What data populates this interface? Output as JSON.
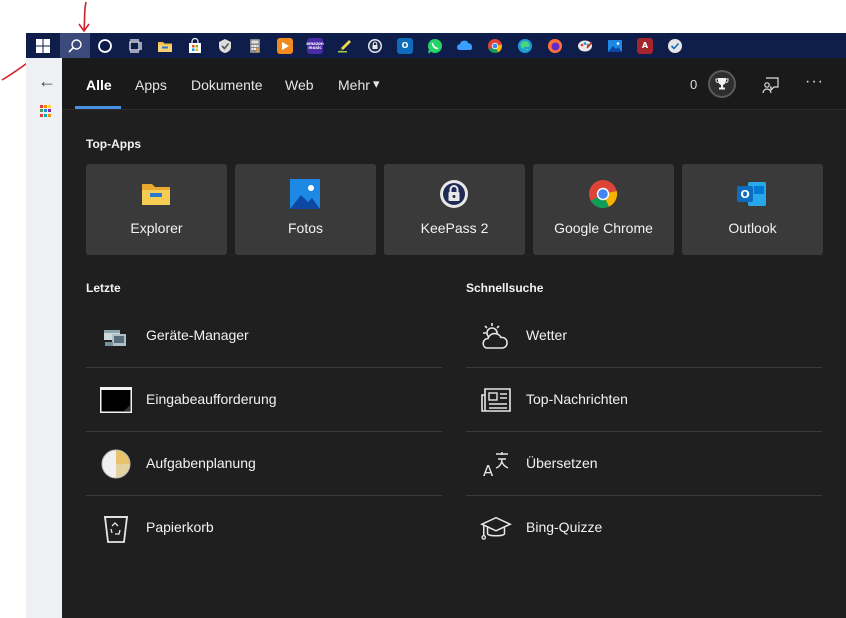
{
  "taskbar": {
    "start": "start-button",
    "items": [
      "search",
      "cortana",
      "task-view",
      "file-explorer",
      "store",
      "tasks-app",
      "calculator",
      "media-player",
      "amazon-music",
      "pen-app",
      "keepass",
      "outlook",
      "whatsapp",
      "onedrive",
      "chrome",
      "edge",
      "firefox",
      "paint",
      "photos",
      "access",
      "feedback"
    ],
    "amazon_music_label": "amazon music",
    "outlook_label": "O",
    "access_label": "A"
  },
  "search_panel": {
    "tabs": [
      {
        "label": "Alle",
        "active": true
      },
      {
        "label": "Apps"
      },
      {
        "label": "Dokumente"
      },
      {
        "label": "Web"
      },
      {
        "label": "Mehr"
      }
    ],
    "more_arrow": "▾",
    "points": "0",
    "more_options": "···",
    "top_apps_title": "Top-Apps",
    "top_apps": [
      {
        "label": "Explorer",
        "icon": "folder-icon"
      },
      {
        "label": "Fotos",
        "icon": "photos-icon"
      },
      {
        "label": "KeePass 2",
        "icon": "keepass-icon"
      },
      {
        "label": "Google Chrome",
        "icon": "chrome-icon"
      },
      {
        "label": "Outlook",
        "icon": "outlook-icon"
      }
    ],
    "outlook_letter": "O",
    "recent_title": "Letzte",
    "recent": [
      {
        "label": "Geräte-Manager",
        "icon": "device-manager-icon"
      },
      {
        "label": "Eingabeaufforderung",
        "icon": "command-prompt-icon"
      },
      {
        "label": "Aufgabenplanung",
        "icon": "task-scheduler-icon"
      },
      {
        "label": "Papierkorb",
        "icon": "recycle-bin-icon"
      }
    ],
    "quick_search_title": "Schnellsuche",
    "quick_search": [
      {
        "label": "Wetter",
        "icon": "weather-icon"
      },
      {
        "label": "Top-Nachrichten",
        "icon": "news-icon"
      },
      {
        "label": "Übersetzen",
        "icon": "translate-icon"
      },
      {
        "label": "Bing-Quizze",
        "icon": "quiz-icon"
      }
    ]
  },
  "colors": {
    "taskbar": "#0f1d4a",
    "panel": "#1f1f1f",
    "tile": "#3a3a3a",
    "accent": "#4a90e2",
    "annotation": "#d4202a"
  }
}
